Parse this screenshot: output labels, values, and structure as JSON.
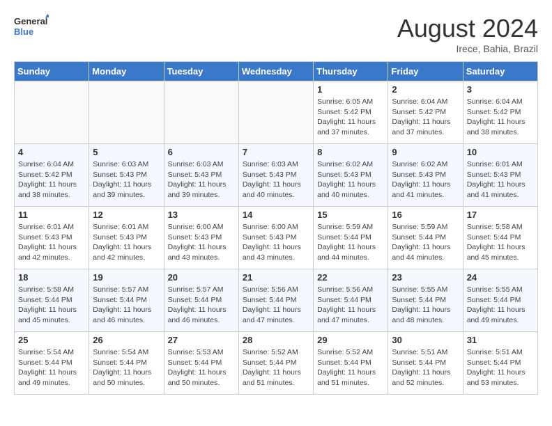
{
  "header": {
    "logo_line1": "General",
    "logo_line2": "Blue",
    "month_title": "August 2024",
    "location": "Irece, Bahia, Brazil"
  },
  "days_of_week": [
    "Sunday",
    "Monday",
    "Tuesday",
    "Wednesday",
    "Thursday",
    "Friday",
    "Saturday"
  ],
  "weeks": [
    [
      {
        "day": "",
        "empty": true
      },
      {
        "day": "",
        "empty": true
      },
      {
        "day": "",
        "empty": true
      },
      {
        "day": "",
        "empty": true
      },
      {
        "day": "1",
        "sunrise": "6:05 AM",
        "sunset": "5:42 PM",
        "daylight": "11 hours and 37 minutes."
      },
      {
        "day": "2",
        "sunrise": "6:04 AM",
        "sunset": "5:42 PM",
        "daylight": "11 hours and 37 minutes."
      },
      {
        "day": "3",
        "sunrise": "6:04 AM",
        "sunset": "5:42 PM",
        "daylight": "11 hours and 38 minutes."
      }
    ],
    [
      {
        "day": "4",
        "sunrise": "6:04 AM",
        "sunset": "5:42 PM",
        "daylight": "11 hours and 38 minutes."
      },
      {
        "day": "5",
        "sunrise": "6:03 AM",
        "sunset": "5:43 PM",
        "daylight": "11 hours and 39 minutes."
      },
      {
        "day": "6",
        "sunrise": "6:03 AM",
        "sunset": "5:43 PM",
        "daylight": "11 hours and 39 minutes."
      },
      {
        "day": "7",
        "sunrise": "6:03 AM",
        "sunset": "5:43 PM",
        "daylight": "11 hours and 40 minutes."
      },
      {
        "day": "8",
        "sunrise": "6:02 AM",
        "sunset": "5:43 PM",
        "daylight": "11 hours and 40 minutes."
      },
      {
        "day": "9",
        "sunrise": "6:02 AM",
        "sunset": "5:43 PM",
        "daylight": "11 hours and 41 minutes."
      },
      {
        "day": "10",
        "sunrise": "6:01 AM",
        "sunset": "5:43 PM",
        "daylight": "11 hours and 41 minutes."
      }
    ],
    [
      {
        "day": "11",
        "sunrise": "6:01 AM",
        "sunset": "5:43 PM",
        "daylight": "11 hours and 42 minutes."
      },
      {
        "day": "12",
        "sunrise": "6:01 AM",
        "sunset": "5:43 PM",
        "daylight": "11 hours and 42 minutes."
      },
      {
        "day": "13",
        "sunrise": "6:00 AM",
        "sunset": "5:43 PM",
        "daylight": "11 hours and 43 minutes."
      },
      {
        "day": "14",
        "sunrise": "6:00 AM",
        "sunset": "5:43 PM",
        "daylight": "11 hours and 43 minutes."
      },
      {
        "day": "15",
        "sunrise": "5:59 AM",
        "sunset": "5:44 PM",
        "daylight": "11 hours and 44 minutes."
      },
      {
        "day": "16",
        "sunrise": "5:59 AM",
        "sunset": "5:44 PM",
        "daylight": "11 hours and 44 minutes."
      },
      {
        "day": "17",
        "sunrise": "5:58 AM",
        "sunset": "5:44 PM",
        "daylight": "11 hours and 45 minutes."
      }
    ],
    [
      {
        "day": "18",
        "sunrise": "5:58 AM",
        "sunset": "5:44 PM",
        "daylight": "11 hours and 45 minutes."
      },
      {
        "day": "19",
        "sunrise": "5:57 AM",
        "sunset": "5:44 PM",
        "daylight": "11 hours and 46 minutes."
      },
      {
        "day": "20",
        "sunrise": "5:57 AM",
        "sunset": "5:44 PM",
        "daylight": "11 hours and 46 minutes."
      },
      {
        "day": "21",
        "sunrise": "5:56 AM",
        "sunset": "5:44 PM",
        "daylight": "11 hours and 47 minutes."
      },
      {
        "day": "22",
        "sunrise": "5:56 AM",
        "sunset": "5:44 PM",
        "daylight": "11 hours and 47 minutes."
      },
      {
        "day": "23",
        "sunrise": "5:55 AM",
        "sunset": "5:44 PM",
        "daylight": "11 hours and 48 minutes."
      },
      {
        "day": "24",
        "sunrise": "5:55 AM",
        "sunset": "5:44 PM",
        "daylight": "11 hours and 49 minutes."
      }
    ],
    [
      {
        "day": "25",
        "sunrise": "5:54 AM",
        "sunset": "5:44 PM",
        "daylight": "11 hours and 49 minutes."
      },
      {
        "day": "26",
        "sunrise": "5:54 AM",
        "sunset": "5:44 PM",
        "daylight": "11 hours and 50 minutes."
      },
      {
        "day": "27",
        "sunrise": "5:53 AM",
        "sunset": "5:44 PM",
        "daylight": "11 hours and 50 minutes."
      },
      {
        "day": "28",
        "sunrise": "5:52 AM",
        "sunset": "5:44 PM",
        "daylight": "11 hours and 51 minutes."
      },
      {
        "day": "29",
        "sunrise": "5:52 AM",
        "sunset": "5:44 PM",
        "daylight": "11 hours and 51 minutes."
      },
      {
        "day": "30",
        "sunrise": "5:51 AM",
        "sunset": "5:44 PM",
        "daylight": "11 hours and 52 minutes."
      },
      {
        "day": "31",
        "sunrise": "5:51 AM",
        "sunset": "5:44 PM",
        "daylight": "11 hours and 53 minutes."
      }
    ]
  ]
}
